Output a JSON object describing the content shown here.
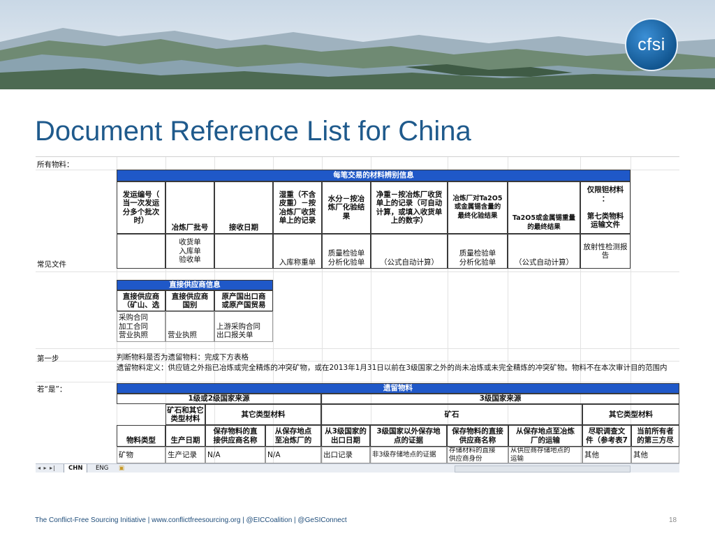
{
  "slide": {
    "logo_text": "cfsi",
    "title": "Document Reference List for China",
    "footer": "The Conflict-Free Sourcing Initiative | www.conflictfreesourcing.org | @EICCoalition | @GeSIConnect",
    "page_number": "18"
  },
  "sheet": {
    "row_labels": {
      "all_materials": "所有物料：",
      "common_docs": "常见文件",
      "step1": "第一步",
      "if_yes": "若“是”："
    },
    "table1": {
      "header": "每笔交易的材料辨别信息",
      "columns": [
        "发运编号（\n当一次发运\n分多个批次\n时）",
        "冶炼厂批号",
        "接收日期",
        "湿重（不含\n皮重）－按\n冶炼厂收货\n单上的记录",
        "水分－按冶\n炼厂化验结\n果",
        "净重－按冶炼厂收货\n单上的记录（可自动\n计算，或填入收货单\n上的数字）",
        "冶炼厂对Ta2O5\n或金属锡含量的\n最终化验结果",
        "Ta2O5或金属锡重量\n的最终结果",
        "仅限钽材料\n：\n\n第七类物料\n运输文件"
      ],
      "docs": [
        "",
        "收货单\n入库单\n验收单",
        "",
        "入库称重单",
        "质量检验单\n分析化验单",
        "（公式自动计算）",
        "质量检验单\n分析化验单",
        "（公式自动计算）",
        "放射性检测报\n告"
      ]
    },
    "table2": {
      "header": "直接供应商信息",
      "columns": [
        "直接供应商\n（矿山、选",
        "直接供应商\n国别",
        "原产国出口商\n或原产国贸易"
      ],
      "docs": [
        "采购合同\n加工合同\n营业执照",
        "\n\n营业执照",
        "\n上游采购合同\n出口报关单"
      ]
    },
    "step1_text": [
      "判断物料是否为遗留物料：完成下方表格",
      "遗留物料定义：供应链之外指已冶炼或完全精炼的冲突矿物，或在2013年1月31日以前在3级国家之外的尚未冶炼或未完全精炼的冲突矿物。物料不在本次审计目的范围内"
    ],
    "table3": {
      "header": "遗留物料",
      "group1": "1级或2级国家来源",
      "group2": "3级国家来源",
      "sub_ore": "矿石和其它\n类型材料",
      "sub_other1": "其它类型材料",
      "sub_ore2": "矿石",
      "sub_other2": "其它类型材料",
      "columns": [
        "物料类型",
        "生产日期",
        "保存物料的直\n接供应商名称",
        "从保存地点\n至冶炼厂的",
        "从3级国家的\n出口日期",
        "3级国家以外保存地\n点的证据",
        "保存物料的直接\n供应商名称",
        "从保存地点至冶炼\n厂的运输",
        "尽职调查文\n件（参考表7",
        "当前所有者\n的第三方尽"
      ],
      "row1": [
        "矿物",
        "生产记录",
        "N/A",
        "N/A",
        "出口记录",
        "非3级存储地点的证据",
        "存储材料的直接\n供应商身份",
        "从供应商存储地点的\n运输",
        "其他",
        "其他"
      ]
    },
    "tabs": [
      "CHN",
      "ENG"
    ]
  }
}
